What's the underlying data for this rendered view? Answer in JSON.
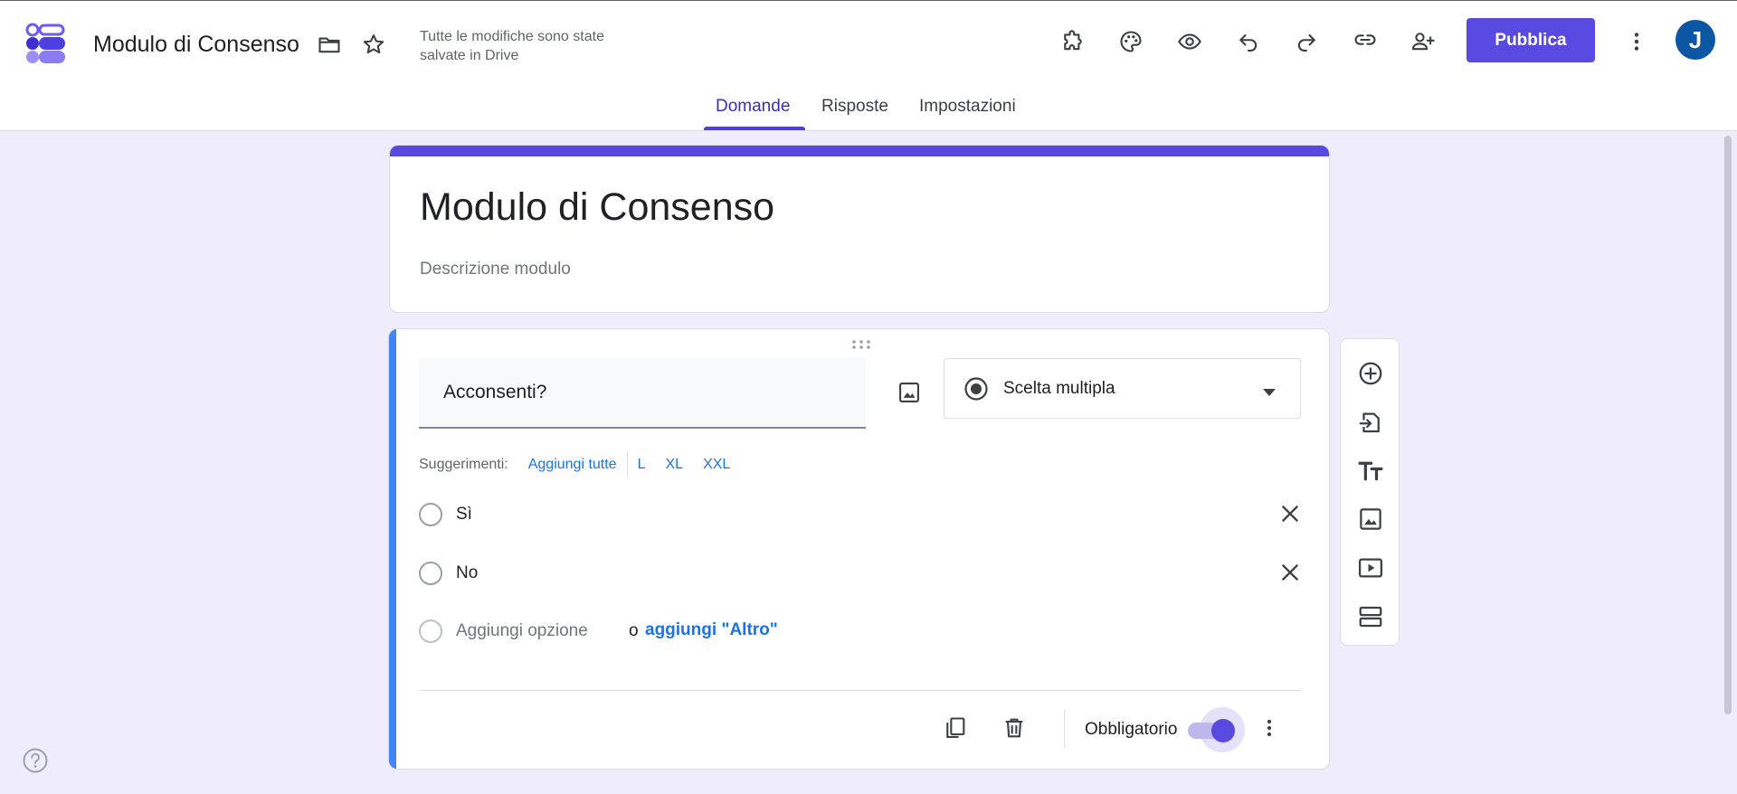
{
  "header": {
    "title": "Modulo di Consenso",
    "save_status": "Tutte le modifiche sono state salvate in Drive",
    "publish_label": "Pubblica",
    "avatar_initial": "J"
  },
  "tabs": [
    {
      "label": "Domande",
      "active": true
    },
    {
      "label": "Risposte",
      "active": false
    },
    {
      "label": "Impostazioni",
      "active": false
    }
  ],
  "form": {
    "title": "Modulo di Consenso",
    "description_placeholder": "Descrizione modulo"
  },
  "question": {
    "text": "Acconsenti?",
    "type_label": "Scelta multipla",
    "suggestions": {
      "label": "Suggerimenti:",
      "chips": [
        "Aggiungi tutte",
        "L",
        "XL",
        "XXL"
      ]
    },
    "options": [
      "Sì",
      "No"
    ],
    "add_option_label": "Aggiungi opzione",
    "or_label": "o",
    "add_other_label": "aggiungi \"Altro\"",
    "required_label": "Obbligatorio",
    "required": true
  },
  "colors": {
    "accent": "#5849e0",
    "active_question_bar": "#4285f4",
    "link": "#1a73e8",
    "canvas_bg": "#efedfb"
  },
  "icons": {
    "header": [
      "folder-icon",
      "star-icon",
      "addons-icon",
      "palette-icon",
      "preview-icon",
      "undo-icon",
      "redo-icon",
      "link-icon",
      "add-collaborator-icon",
      "more-vert-icon"
    ],
    "side_toolbar": [
      "add-question-icon",
      "import-questions-icon",
      "add-title-icon",
      "add-image-icon",
      "add-video-icon",
      "add-section-icon"
    ],
    "footer": [
      "duplicate-icon",
      "delete-icon",
      "more-vert-icon"
    ]
  }
}
